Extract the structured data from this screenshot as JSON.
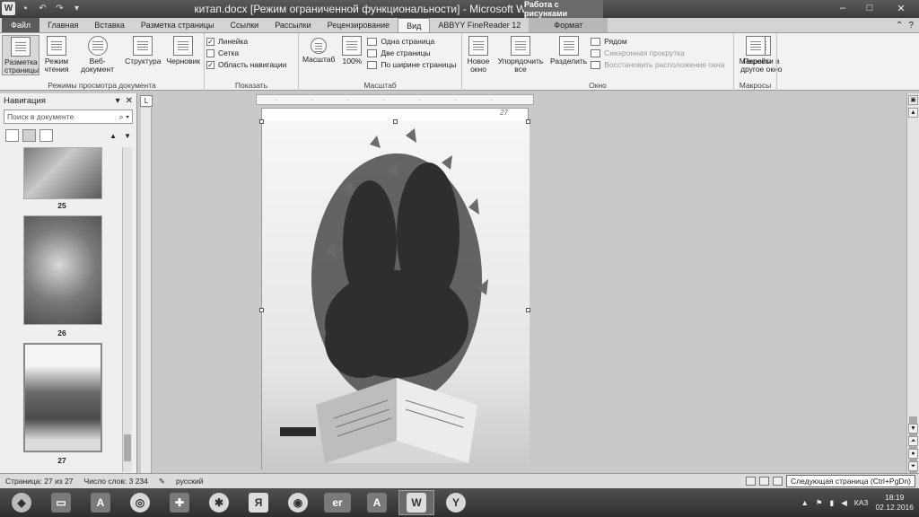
{
  "window": {
    "title": "китап.docx [Режим ограниченной функциональности] - Microsoft Word",
    "context_group": "Работа с рисунками"
  },
  "tabs": [
    {
      "label": "Файл",
      "kind": "file"
    },
    {
      "label": "Главная"
    },
    {
      "label": "Вставка"
    },
    {
      "label": "Разметка страницы"
    },
    {
      "label": "Ссылки"
    },
    {
      "label": "Рассылки"
    },
    {
      "label": "Рецензирование"
    },
    {
      "label": "Вид",
      "active": true
    },
    {
      "label": "ABBYY FineReader 12"
    },
    {
      "label": "Формат",
      "kind": "ctx"
    }
  ],
  "ribbon": {
    "views": {
      "label": "Режимы просмотра документа",
      "buttons": [
        "Разметка страницы",
        "Режим чтения",
        "Веб-документ",
        "Структура",
        "Черновик"
      ]
    },
    "show": {
      "label": "Показать",
      "ruler": "Линейка",
      "grid": "Сетка",
      "navpane": "Область навигации"
    },
    "zoom": {
      "label": "Масштаб",
      "zoom": "Масштаб",
      "hundred": "100%",
      "one_page": "Одна страница",
      "two_pages": "Две страницы",
      "page_width": "По ширине страницы"
    },
    "window": {
      "label": "Окно",
      "new_window": "Новое окно",
      "arrange": "Упорядочить все",
      "split": "Разделить",
      "side_by_side": "Рядом",
      "sync_scroll": "Синхронная прокрутка",
      "reset_pos": "Восстановить расположение окна",
      "switch": "Перейти в другое окно"
    },
    "macros": {
      "label": "Макросы",
      "macros": "Макросы"
    }
  },
  "nav": {
    "title": "Навигация",
    "search_placeholder": "Поиск в документе",
    "pages": [
      "25",
      "26",
      "27"
    ]
  },
  "document": {
    "page_mark": "27"
  },
  "status": {
    "page": "Страница: 27 из 27",
    "words": "Число слов: 3 234",
    "lang": "русский",
    "tooltip": "Следующая страница (Ctrl+PgDn)"
  },
  "taskbar": {
    "lang": "КАЗ",
    "time": "18:19",
    "date": "02.12.2016"
  }
}
